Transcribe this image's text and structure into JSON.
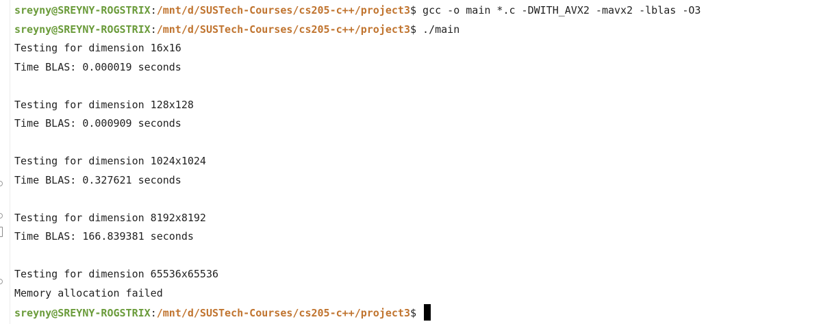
{
  "prompt": {
    "user": "sreyny@SREYNY-ROGSTRIX",
    "colon": ":",
    "path": "/mnt/d/SUSTech-Courses/cs205-c++/project3",
    "dollar": "$ "
  },
  "lines": [
    {
      "type": "prompt",
      "command": "gcc -o main *.c -DWITH_AVX2 -mavx2 -lblas -O3"
    },
    {
      "type": "prompt",
      "command": "./main"
    },
    {
      "type": "output",
      "text": "Testing for dimension 16x16"
    },
    {
      "type": "output",
      "text": "Time BLAS: 0.000019 seconds"
    },
    {
      "type": "output",
      "text": ""
    },
    {
      "type": "output",
      "text": "Testing for dimension 128x128"
    },
    {
      "type": "output",
      "text": "Time BLAS: 0.000909 seconds"
    },
    {
      "type": "output",
      "text": ""
    },
    {
      "type": "output",
      "text": "Testing for dimension 1024x1024"
    },
    {
      "type": "output",
      "text": "Time BLAS: 0.327621 seconds"
    },
    {
      "type": "output",
      "text": ""
    },
    {
      "type": "output",
      "text": "Testing for dimension 8192x8192"
    },
    {
      "type": "output",
      "text": "Time BLAS: 166.839381 seconds"
    },
    {
      "type": "output",
      "text": ""
    },
    {
      "type": "output",
      "text": "Testing for dimension 65536x65536"
    },
    {
      "type": "output",
      "text": "Memory allocation failed"
    },
    {
      "type": "prompt",
      "command": "",
      "cursor": true
    }
  ]
}
